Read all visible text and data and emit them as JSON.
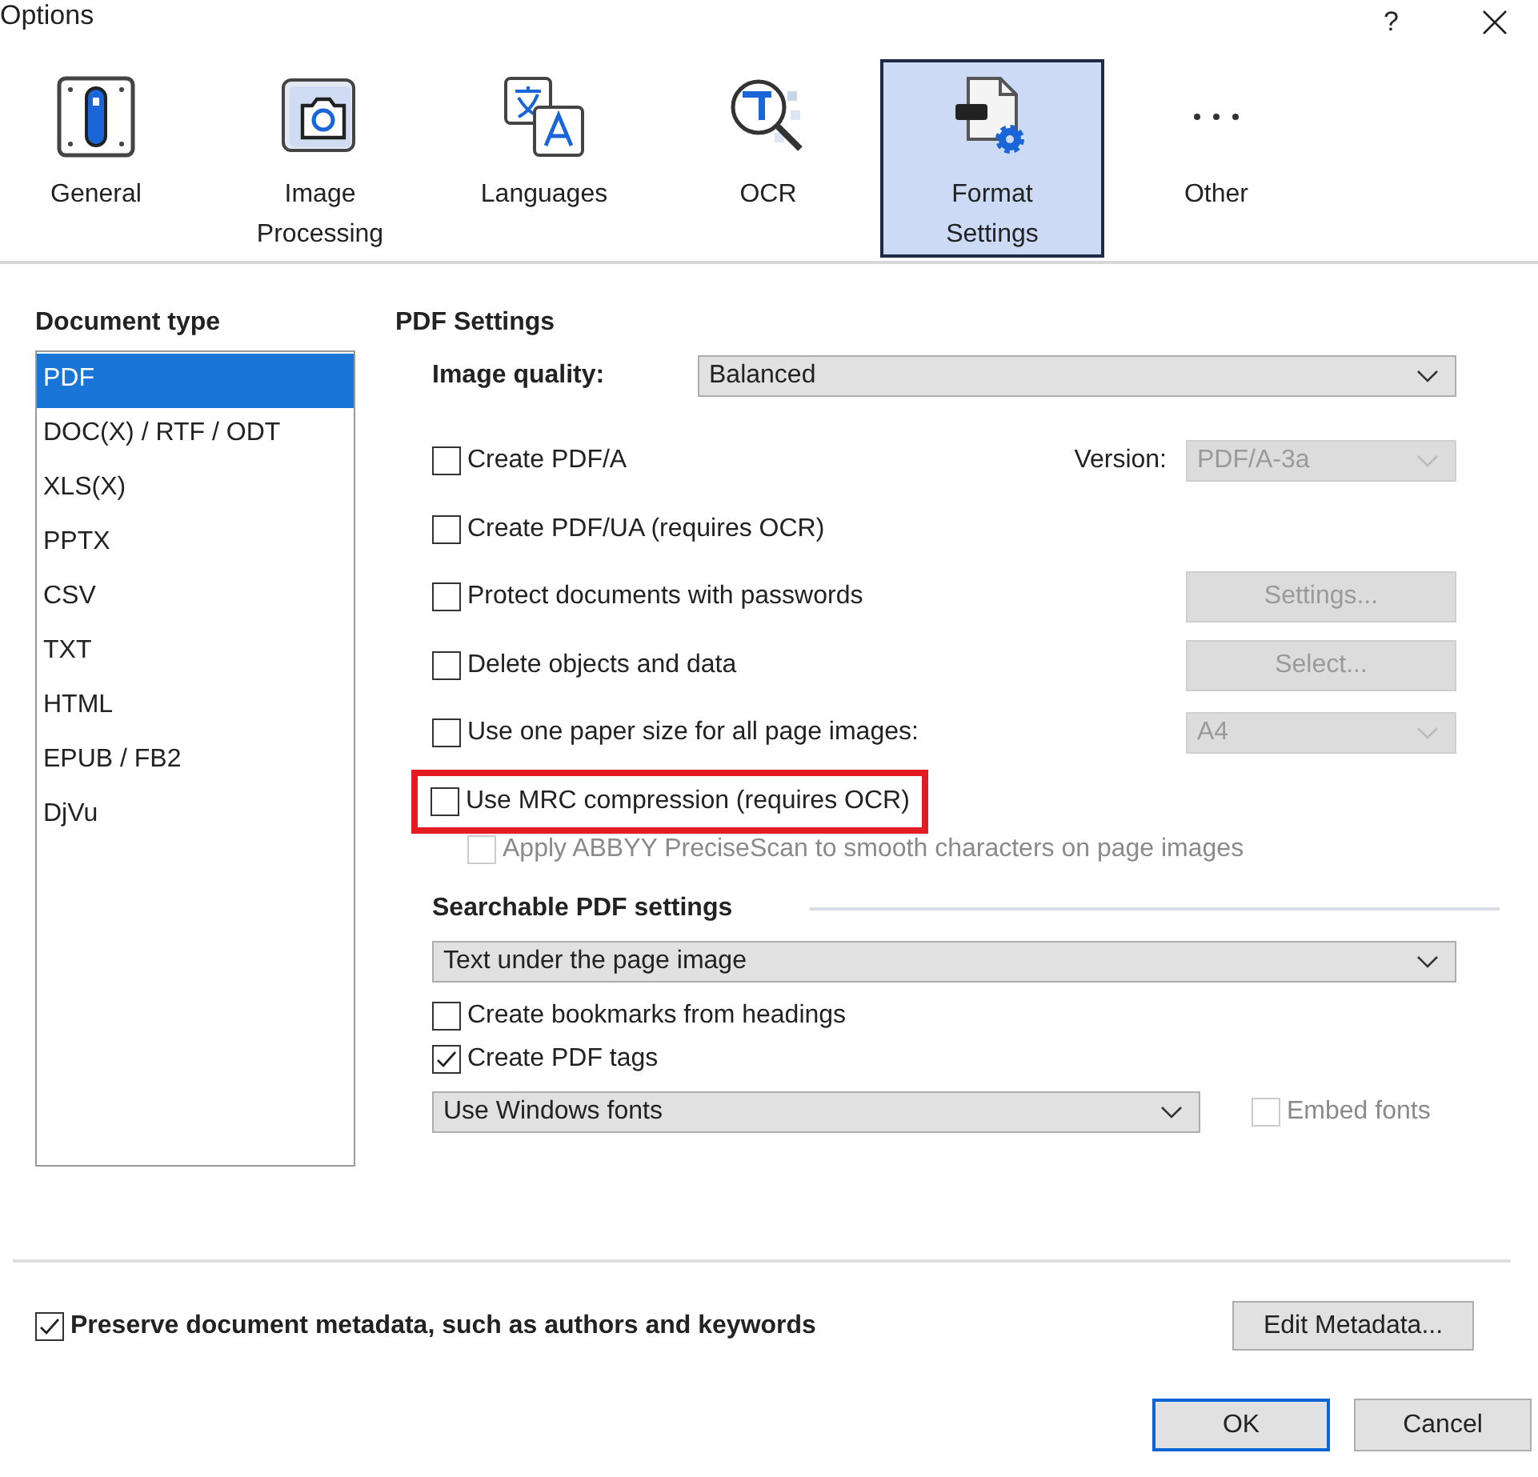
{
  "window": {
    "title": "Options",
    "help": "?"
  },
  "tabs": [
    {
      "label": "General",
      "kind": "general",
      "selected": false
    },
    {
      "label": "Image Processing",
      "kind": "camera",
      "selected": false
    },
    {
      "label": "Languages",
      "kind": "languages",
      "selected": false
    },
    {
      "label": "OCR",
      "kind": "ocr",
      "selected": false
    },
    {
      "label": "Format Settings",
      "kind": "format",
      "selected": true
    },
    {
      "label": "Other",
      "kind": "more",
      "selected": false
    }
  ],
  "document_types": {
    "heading": "Document type",
    "items": [
      {
        "label": "PDF",
        "selected": true
      },
      {
        "label": "DOC(X) / RTF / ODT",
        "selected": false
      },
      {
        "label": "XLS(X)",
        "selected": false
      },
      {
        "label": "PPTX",
        "selected": false
      },
      {
        "label": "CSV",
        "selected": false
      },
      {
        "label": "TXT",
        "selected": false
      },
      {
        "label": "HTML",
        "selected": false
      },
      {
        "label": "EPUB / FB2",
        "selected": false
      },
      {
        "label": "DjVu",
        "selected": false
      }
    ]
  },
  "pdf_settings": {
    "heading": "PDF Settings",
    "image_quality": {
      "label": "Image quality:",
      "value": "Balanced"
    },
    "options": [
      {
        "kind": "checkbox",
        "label": "Create PDF/A",
        "checked": false,
        "side": {
          "kind": "dropdown",
          "label": "Version:",
          "value": "PDF/A-3a",
          "disabled": true
        }
      },
      {
        "kind": "checkbox",
        "label": "Create PDF/UA (requires OCR)",
        "checked": false
      },
      {
        "kind": "checkbox",
        "label": "Protect documents with passwords",
        "checked": false,
        "side": {
          "kind": "button",
          "value": "Settings...",
          "disabled": true
        }
      },
      {
        "kind": "checkbox",
        "label": "Delete objects and data",
        "checked": false,
        "side": {
          "kind": "button",
          "value": "Select...",
          "disabled": true
        }
      },
      {
        "kind": "checkbox",
        "label": "Use one paper size for all page images:",
        "checked": false,
        "side": {
          "kind": "dropdown",
          "value": "A4",
          "disabled": true
        }
      },
      {
        "kind": "checkbox",
        "label": "Use MRC compression (requires OCR)",
        "checked": false,
        "highlighted": true
      },
      {
        "kind": "subcheckbox",
        "label": "Apply ABBYY PreciseScan to smooth characters on page images",
        "checked": false,
        "disabled": true
      }
    ]
  },
  "searchable": {
    "heading": "Searchable PDF settings",
    "mode": "Text under the page image",
    "options": [
      {
        "label": "Create bookmarks from headings",
        "checked": false
      },
      {
        "label": "Create PDF tags",
        "checked": true
      }
    ],
    "fonts": "Use Windows fonts",
    "embed": {
      "label": "Embed fonts",
      "checked": false,
      "disabled": true
    }
  },
  "footer": {
    "metadata": {
      "label": "Preserve document metadata, such as authors and keywords",
      "checked": true
    },
    "edit_button": "Edit Metadata...",
    "buttons": [
      {
        "label": "OK",
        "default": true
      },
      {
        "label": "Cancel",
        "default": false
      }
    ]
  }
}
